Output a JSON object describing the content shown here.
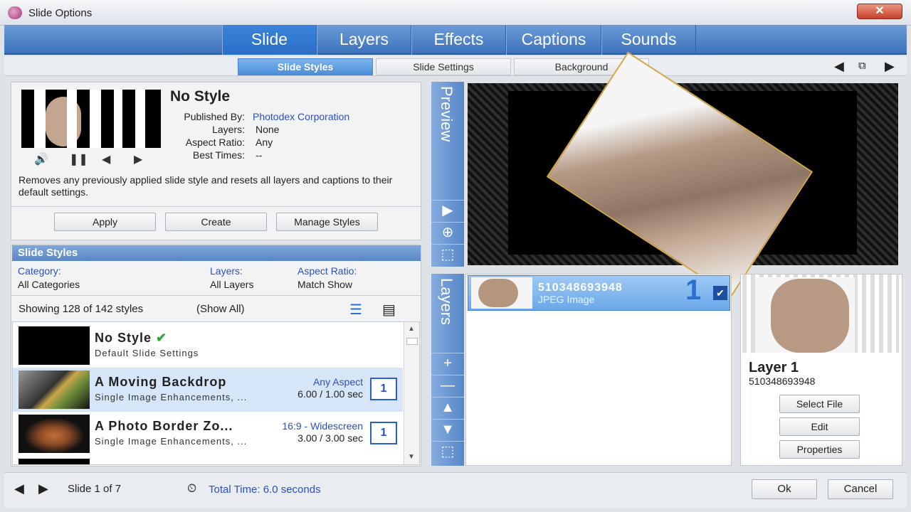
{
  "window": {
    "title": "Slide Options",
    "close_label": "✕"
  },
  "main_tabs": [
    {
      "label": "Slide"
    },
    {
      "label": "Layers"
    },
    {
      "label": "Effects"
    },
    {
      "label": "Captions"
    },
    {
      "label": "Sounds"
    }
  ],
  "sub_tabs": [
    {
      "label": "Slide Styles"
    },
    {
      "label": "Slide Settings"
    },
    {
      "label": "Background"
    }
  ],
  "style_info": {
    "name": "No Style",
    "published_by_label": "Published By:",
    "published_by": "Photodex Corporation",
    "layers_label": "Layers:",
    "layers": "None",
    "aspect_label": "Aspect Ratio:",
    "aspect": "Any",
    "best_times_label": "Best Times:",
    "best_times": "--",
    "description": "Removes any previously applied slide style and resets all layers and captions to their default settings."
  },
  "style_buttons": {
    "apply": "Apply",
    "create": "Create",
    "manage": "Manage Styles"
  },
  "slide_styles": {
    "heading": "Slide Styles",
    "category_label": "Category:",
    "category_value": "All Categories",
    "layers_label": "Layers:",
    "layers_value": "All Layers",
    "aspect_label": "Aspect Ratio:",
    "aspect_value": "Match Show",
    "count_text": "Showing 128 of 142 styles",
    "show_all": "(Show All)",
    "items": [
      {
        "name": "No Style",
        "sub": "Default Slide Settings",
        "aspect": "",
        "time": "",
        "badge": ""
      },
      {
        "name": "A Moving Backdrop",
        "sub": "Single Image Enhancements, ...",
        "aspect": "Any Aspect",
        "time": "6.00 / 1.00 sec",
        "badge": "1"
      },
      {
        "name": "A Photo Border Zo...",
        "sub": "Single Image Enhancements, ...",
        "aspect": "16:9 - Widescreen",
        "time": "3.00 / 3.00 sec",
        "badge": "1"
      }
    ]
  },
  "preview": {
    "label": "Preview"
  },
  "layers_panel": {
    "label": "Layers",
    "item": {
      "name": "510348693948",
      "type": "JPEG Image",
      "number": "1"
    }
  },
  "layer_props": {
    "title": "Layer 1",
    "file": "510348693948",
    "select_file": "Select File",
    "edit": "Edit",
    "properties": "Properties"
  },
  "footer": {
    "slide_counter": "Slide 1 of 7",
    "total_time": "Total Time: 6.0 seconds",
    "ok": "Ok",
    "cancel": "Cancel"
  },
  "colors": {
    "accent": "#3e72bd",
    "link": "#2b4fc7",
    "selection": "#d6e6f8"
  }
}
